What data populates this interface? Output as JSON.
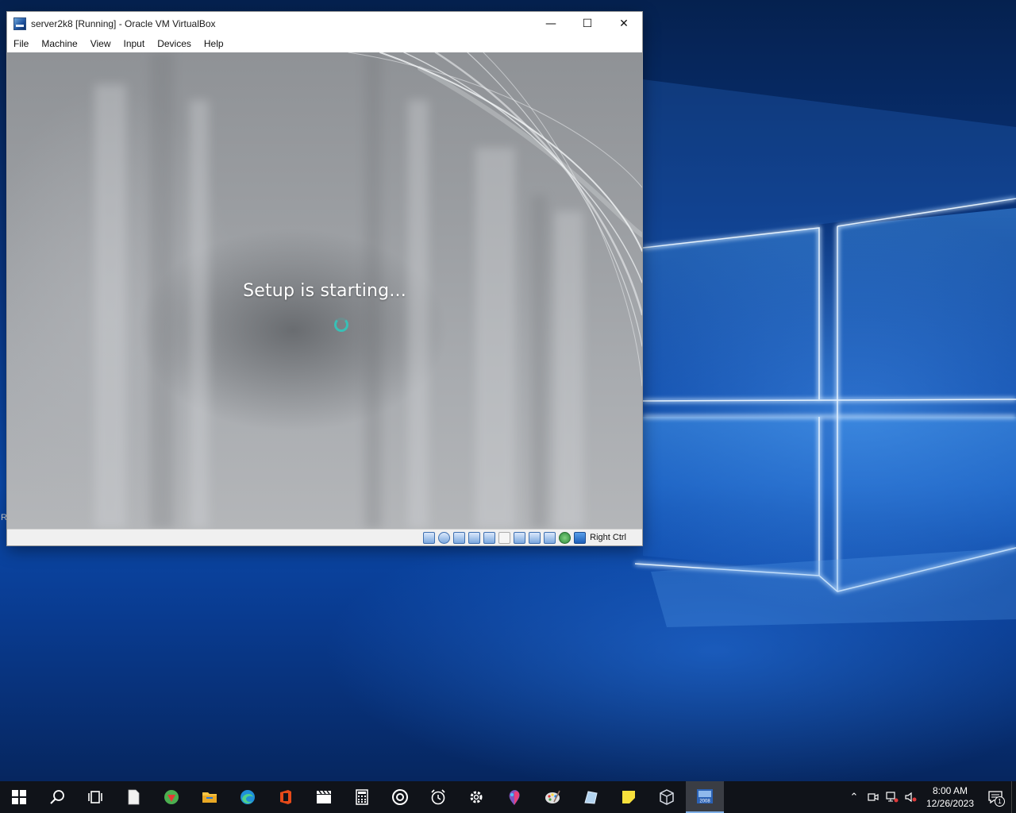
{
  "desktop": {
    "left_edge_label": "R"
  },
  "window": {
    "title": "server2k8 [Running] - Oracle VM VirtualBox",
    "controls": {
      "minimize": "—",
      "maximize": "☐",
      "close": "✕"
    },
    "menu": [
      "File",
      "Machine",
      "View",
      "Input",
      "Devices",
      "Help"
    ],
    "vm_screen": {
      "message": "Setup is starting...",
      "spinner_color": "#38c0b6"
    },
    "statusbar": {
      "icons": [
        "hard-disk-icon",
        "optical-drive-icon",
        "audio-icon",
        "network-icon",
        "usb-icon",
        "shared-folders-icon",
        "display-icon",
        "recording-icon",
        "video-capture-icon",
        "vt-x-icon",
        "mouse-integration-icon",
        "keyboard-capture-icon"
      ],
      "host_key": "Right Ctrl"
    }
  },
  "taskbar": {
    "apps": [
      {
        "name": "start",
        "icon": "windows-logo-icon"
      },
      {
        "name": "search",
        "icon": "search-icon"
      },
      {
        "name": "task-view",
        "icon": "task-view-icon"
      },
      {
        "name": "notepad",
        "icon": "blank-document-icon"
      },
      {
        "name": "gem-app",
        "icon": "gem-icon"
      },
      {
        "name": "file-explorer",
        "icon": "folder-icon"
      },
      {
        "name": "edge",
        "icon": "edge-icon"
      },
      {
        "name": "office",
        "icon": "office-icon"
      },
      {
        "name": "movies",
        "icon": "clapperboard-icon"
      },
      {
        "name": "calculator",
        "icon": "calculator-icon"
      },
      {
        "name": "groove",
        "icon": "disc-icon"
      },
      {
        "name": "alarms",
        "icon": "alarm-clock-icon"
      },
      {
        "name": "settings",
        "icon": "gear-icon"
      },
      {
        "name": "paint3d",
        "icon": "paint-drop-icon"
      },
      {
        "name": "paint",
        "icon": "palette-icon"
      },
      {
        "name": "snip",
        "icon": "snip-icon"
      },
      {
        "name": "sticky-notes",
        "icon": "sticky-note-icon"
      },
      {
        "name": "virtualbox",
        "icon": "virtualbox-cube-icon"
      },
      {
        "name": "server2k8-vm",
        "icon": "server-2008-icon",
        "label": "2008",
        "active": true
      }
    ],
    "tray": {
      "chevron": "⌃",
      "clock_time": "8:00 AM",
      "clock_date": "12/26/2023",
      "notification_count": "1"
    }
  }
}
